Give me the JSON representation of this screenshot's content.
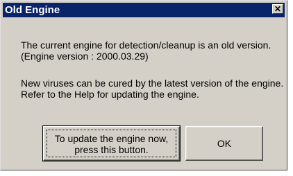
{
  "dialog": {
    "title": "Old Engine",
    "close_glyph": "✕",
    "message_lines": [
      "The current engine for detection/cleanup is an old version.",
      "(Engine version : 2000.03.29)",
      "New viruses can be cured by the latest version of the engine.",
      "Refer to the Help for updating the engine."
    ],
    "buttons": {
      "update_line1": "To update the engine now,",
      "update_line2": "press this button.",
      "ok": "OK"
    }
  },
  "colors": {
    "titlebar": "#0a246a",
    "face": "#d4d0c8"
  },
  "icons": {
    "close": "close-icon"
  }
}
